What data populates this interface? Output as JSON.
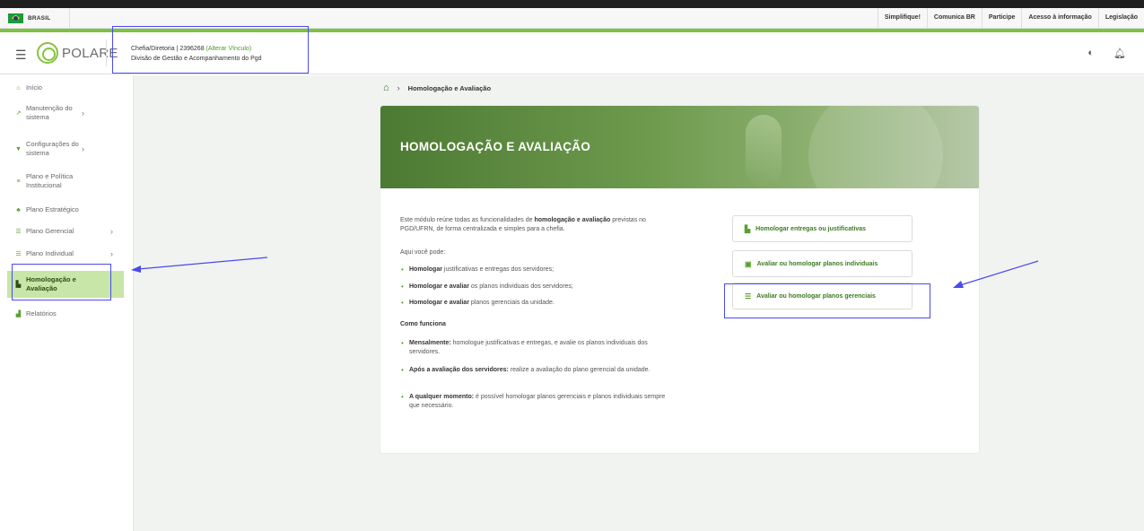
{
  "gov_bar": {
    "country": "BRASIL",
    "links": [
      "Simplifique!",
      "Comunica BR",
      "Participe",
      "Acesso à informação",
      "Legislação"
    ]
  },
  "header": {
    "logo_text": "POLARE",
    "vinculo_line1_prefix": "Chefia/Diretoria |  2396268 ",
    "vinculo_link": "(Alterar Vínculo)",
    "vinculo_line2": "Divisão de Gestão e Acompanhamento do Pgd"
  },
  "sidebar": {
    "items": [
      {
        "label": "Início"
      },
      {
        "label": "Manutenção do sistema"
      },
      {
        "label": "Configurações do sistema"
      },
      {
        "label": "Plano e Política Institucional"
      },
      {
        "label": "Plano Estratégico"
      },
      {
        "label": "Plano Gerencial"
      },
      {
        "label": "Plano Individual"
      },
      {
        "label": "Homologação e Avaliação"
      },
      {
        "label": "Relatórios"
      }
    ]
  },
  "breadcrumb": {
    "current": "Homologação e Avaliação"
  },
  "banner": {
    "title": "HOMOLOGAÇÃO E AVALIAÇÃO"
  },
  "main": {
    "intro_pre": "Este módulo reúne todas as funcionalidades de ",
    "intro_bold": "homologação e avaliação",
    "intro_post": " previstas no PGD/UFRN, de forma centralizada e simples para a chefia.",
    "here_you_can": "Aqui você pode:",
    "can_items": [
      {
        "bold": "Homologar",
        "text": " justificativas e entregas dos servidores;"
      },
      {
        "bold": "Homologar e avaliar",
        "text": " os planos individuais dos servidores;"
      },
      {
        "bold": "Homologar e avaliar",
        "text": " planos gerenciais da unidade."
      }
    ],
    "how_title": "Como funciona",
    "how_items": [
      {
        "bold": "Mensalmente:",
        "text": " homologue justificativas e entregas, e avalie os planos individuais dos servidores."
      },
      {
        "bold": "Após a avaliação dos servidores:",
        "text": " realize a avaliação do plano gerencial da unidade."
      },
      {
        "bold": "A qualquer momento:",
        "text": " é possível homologar planos gerenciais e planos individuais sempre que necessário."
      }
    ]
  },
  "actions": [
    {
      "label": "Homologar entregas ou justificativas"
    },
    {
      "label": "Avaliar ou homologar planos individuais"
    },
    {
      "label": "Avaliar ou homologar planos gerenciais"
    }
  ],
  "colors": {
    "brand_green": "#7cc243",
    "annotation_blue": "#4a4aee"
  }
}
